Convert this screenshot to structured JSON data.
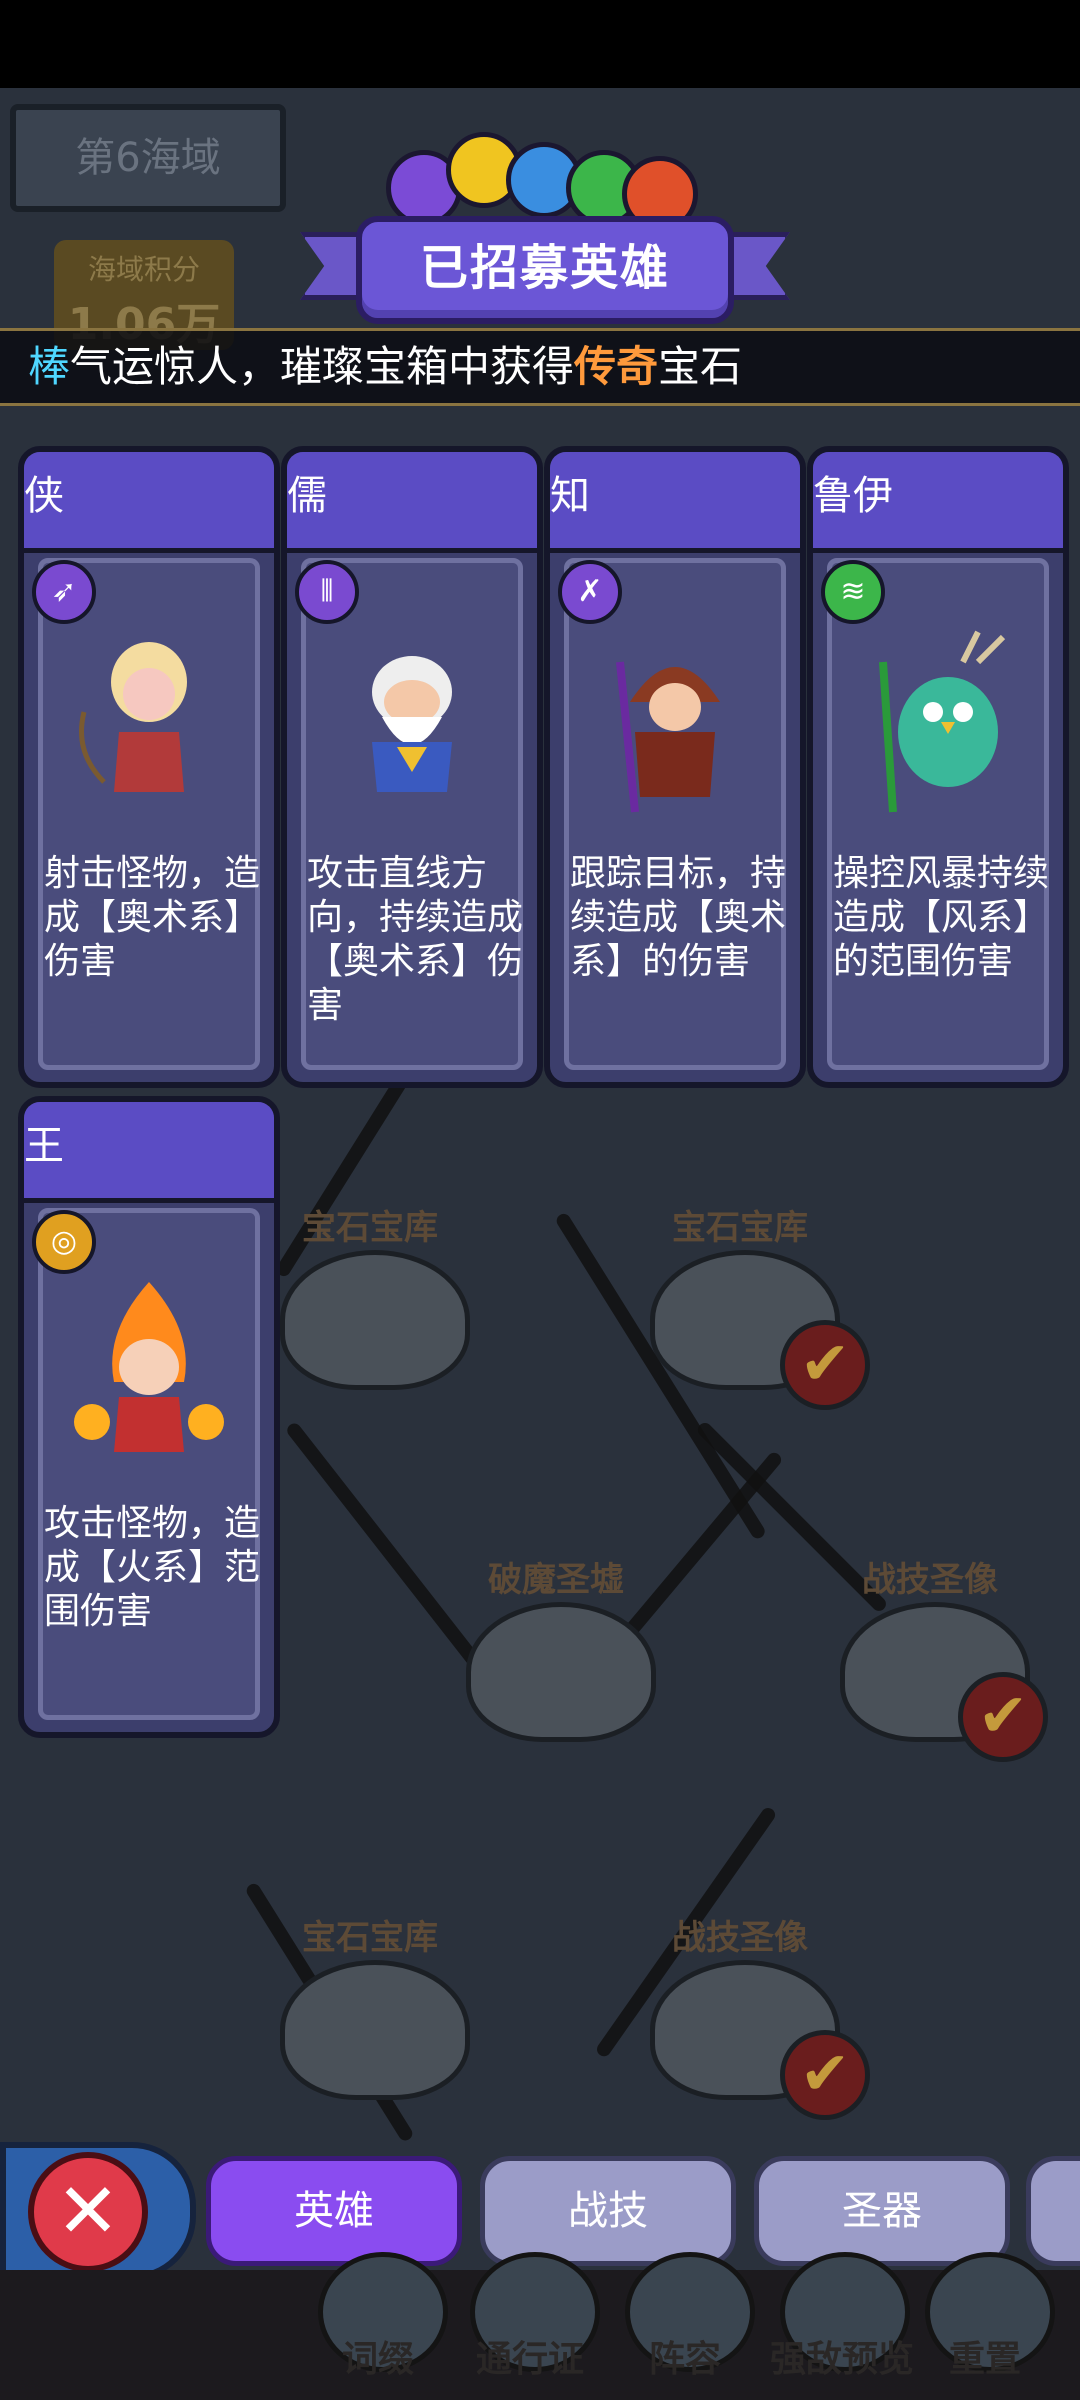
{
  "map": {
    "sea_label": "第6海域",
    "score_label": "海域积分",
    "score_value": "1.06万",
    "nodes": [
      {
        "label": "宝石宝库",
        "checked": false
      },
      {
        "label": "宝石宝库",
        "checked": true
      },
      {
        "label": "破魔圣墟",
        "checked": false
      },
      {
        "label": "战技圣像",
        "checked": true
      },
      {
        "label": "宝石宝库",
        "checked": false
      },
      {
        "label": "战技圣像",
        "checked": true
      }
    ]
  },
  "header": {
    "title": "已招募英雄"
  },
  "ticker": {
    "part1": "棒",
    "part2": "气运惊人，璀璨宝箱中获得",
    "part3": "传奇",
    "part4": "宝石"
  },
  "heroes": [
    {
      "name": "侠",
      "desc": "射击怪物，造成【奥术系】伤害",
      "icon": "arrows-icon",
      "icon_color": "#7a4ad0"
    },
    {
      "name": "儒",
      "desc": "攻击直线方向，持续造成【奥术系】伤害",
      "icon": "beam-icon",
      "icon_color": "#7a4ad0"
    },
    {
      "name": "知",
      "desc": "跟踪目标，持续造成【奥术系】的伤害",
      "icon": "crossed-arrows-icon",
      "icon_color": "#7a4ad0"
    },
    {
      "name": "鲁伊",
      "desc": "操控风暴持续造成【风系】的范围伤害",
      "icon": "wind-icon",
      "icon_color": "#3cb64a"
    },
    {
      "name": "王",
      "desc": "攻击怪物，造成【火系】范围伤害",
      "icon": "fire-ring-icon",
      "icon_color": "#e0a020"
    }
  ],
  "tabs": [
    {
      "label": "英雄",
      "active": true
    },
    {
      "label": "战技",
      "active": false
    },
    {
      "label": "圣器",
      "active": false
    }
  ],
  "nav": [
    "词缀",
    "通行证",
    "阵容",
    "强敌预览",
    "重置"
  ]
}
